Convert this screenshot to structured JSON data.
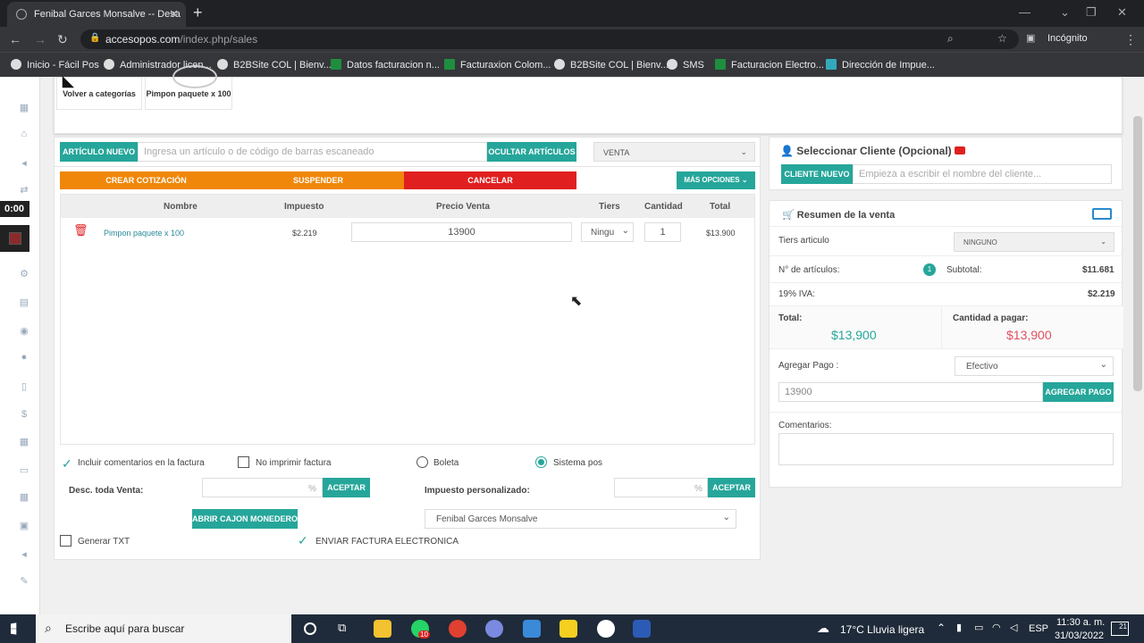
{
  "browser": {
    "tab_title": "Fenibal Garces Monsalve -- Desa",
    "url_domain": "accesopos.com",
    "url_path": "/index.php/sales",
    "incognito": "Incógnito"
  },
  "bookmarks": [
    "Inicio - Fácil Pos",
    "Administrador licen...",
    "B2BSite COL | Bienv...",
    "Datos facturacion n...",
    "Facturaxion Colom...",
    "B2BSite COL | Bienv...",
    "SMS",
    "Facturacion Electro...",
    "Dirección de Impue..."
  ],
  "recorder": {
    "time": "0:00"
  },
  "categories": {
    "back": "Volver a categorías",
    "product": "Pimpon paquete x 100"
  },
  "toolbar": {
    "new_item": "ARTÍCULO NUEVO",
    "search_placeholder": "Ingresa un artículo o de código de barras escaneado",
    "hide_items": "OCULTAR ARTÍCULOS",
    "mode": "VENTA",
    "create_quote": "CREAR COTIZACIÓN",
    "suspend": "SUSPENDER",
    "cancel": "CANCELAR",
    "more_options": "MÁS OPCIONES"
  },
  "colors": {
    "teal": "#26a69a",
    "orange": "#f0870a",
    "red": "#e02020",
    "green_total": "#26a69a",
    "red_total": "#e05060"
  },
  "table": {
    "headers": [
      "Nombre",
      "Impuesto",
      "Precio Venta",
      "Tiers",
      "Cantidad",
      "Total"
    ],
    "rows": [
      {
        "name": "Pimpon paquete x 100",
        "tax": "$2.219",
        "price": "13900",
        "tier": "Ningu",
        "qty": "1",
        "total": "$13.900"
      }
    ]
  },
  "options": {
    "include_comments": "Incluir comentarios en la factura",
    "no_print": "No imprimir factura",
    "boleta": "Boleta",
    "sistema_pos": "Sistema pos",
    "discount_label": "Desc. toda Venta:",
    "percent": "%",
    "accept": "ACEPTAR",
    "custom_tax_label": "Impuesto personalizado:",
    "open_drawer": "ABRIR CAJON MONEDERO",
    "seller": "Fenibal Garces Monsalve",
    "generate_txt": "Generar TXT",
    "e_invoice": "ENVIAR FACTURA ELECTRONICA"
  },
  "client": {
    "title": "Seleccionar Cliente (Opcional)",
    "new_client": "CLIENTE NUEVO",
    "placeholder": "Empieza a escribir el nombre del cliente..."
  },
  "summary": {
    "title": "Resumen de la venta",
    "tiers_label": "Tiers articulo",
    "tiers_value": "NINGUNO",
    "items_label": "N° de artículos:",
    "items_count": "1",
    "subtotal_label": "Subtotal:",
    "subtotal": "$11.681",
    "iva_label": "19% IVA:",
    "iva": "$2.219",
    "total_label": "Total:",
    "total": "$13,900",
    "due_label": "Cantidad a pagar:",
    "due": "$13,900",
    "add_payment_label": "Agregar Pago :",
    "payment_method": "Efectivo",
    "payment_amount": "13900",
    "add_payment_btn": "AGREGAR PAGO",
    "comments_label": "Comentarios:"
  },
  "taskbar": {
    "search": "Escribe aquí para buscar",
    "weather": "17°C  Lluvia ligera",
    "lang": "ESP",
    "time": "11:30 a. m.",
    "date": "31/03/2022",
    "notif": "21",
    "whatsapp_badge": "10"
  }
}
